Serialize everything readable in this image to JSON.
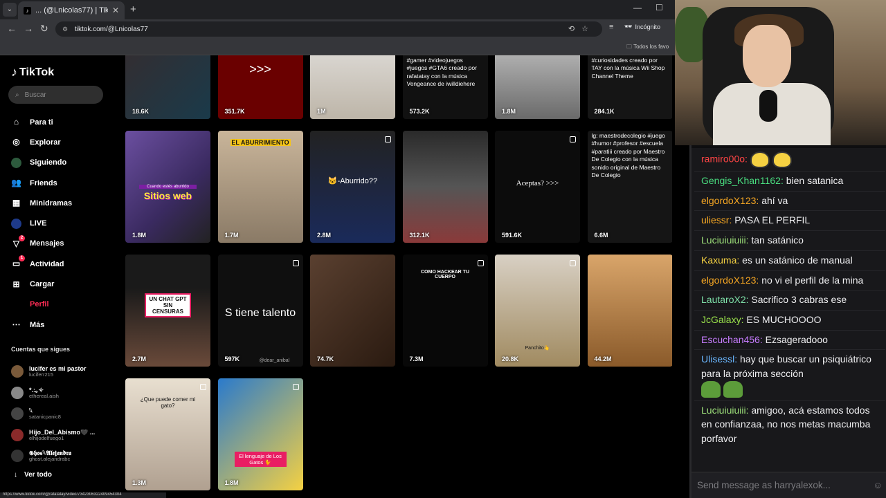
{
  "browser": {
    "tab_title": "... (@Lnicolas77) | TikTok",
    "url": "tiktok.com/@Lnicolas77",
    "incognito_label": "Incógnito",
    "bookmarks_label": "Todos los favo",
    "status_url": "https://www.tiktok.com/@rafatatay/video/7342306322409454304"
  },
  "tiktok": {
    "logo": "TikTok",
    "search_placeholder": "Buscar",
    "nav": [
      {
        "label": "Para ti",
        "icon": "home-icon"
      },
      {
        "label": "Explorar",
        "icon": "compass-icon"
      },
      {
        "label": "Siguiendo",
        "icon": "following-avatar-icon"
      },
      {
        "label": "Friends",
        "icon": "friends-icon"
      },
      {
        "label": "Minidramas",
        "icon": "minidramas-icon"
      },
      {
        "label": "LIVE",
        "icon": "live-icon"
      },
      {
        "label": "Mensajes",
        "icon": "messages-icon",
        "badge": "2"
      },
      {
        "label": "Actividad",
        "icon": "activity-icon",
        "badge": "1"
      },
      {
        "label": "Cargar",
        "icon": "upload-icon"
      },
      {
        "label": "Perfil",
        "icon": "profile-icon"
      },
      {
        "label": "Más",
        "icon": "more-icon"
      }
    ],
    "following_title": "Cuentas que sigues",
    "following": [
      {
        "name": "lucifer es mi pastor",
        "handle": "luciferr215"
      },
      {
        "name": "*.:｡✧",
        "handle": "ethereal.aish"
      },
      {
        "name": "𓆩",
        "handle": "satanicpanic8"
      },
      {
        "name": "Hijo_Del_Abismo🖤 ...",
        "handle": "elhijodelfuego1"
      },
      {
        "name": "𝕲𝖍𝖔𝖘𓆩𝕬𝖑𝖊𝖏𝖆𝖓𝖉𝖗𝖆",
        "handle": "ghost.alejandrabc"
      }
    ],
    "see_all": "Ver todo",
    "videos": [
      {
        "views": "18.6K"
      },
      {
        "views": "351.7K",
        "overlay": ">>>"
      },
      {
        "views": "1M"
      },
      {
        "views": "573.2K",
        "caption": "#gamer #videojuegos #juegos #GTA6 creado por rafatatay con la música Vengeance de iwilldiehere"
      },
      {
        "views": "1.8M"
      },
      {
        "views": "284.1K",
        "caption": "#curiosidades creado por TAY con la música Wii Shop Channel Theme"
      },
      {
        "views": "1.8M",
        "overlay": "Sitios web",
        "subtitle": "Cuando estés aburrido"
      },
      {
        "views": "1.7M",
        "overlay": "EL ABURRIMIENTO"
      },
      {
        "views": "2.8M",
        "overlay": "🐱-Aburrido??"
      },
      {
        "views": "312.1K"
      },
      {
        "views": "591.6K",
        "overlay": "Aceptas? >>>"
      },
      {
        "views": "6.6M",
        "caption": "lg: maestrodecolegio #juego #humor #profesor #escuela #paratiii creado por Maestro De Colegio con la música sonido original de Maestro De Colegio"
      },
      {
        "views": "2.7M",
        "overlay": "UN CHAT GPT SIN CENSURAS"
      },
      {
        "views": "597K",
        "overlay": "S tiene talento",
        "handle": "@dear_anibal"
      },
      {
        "views": "74.7K"
      },
      {
        "views": "7.3M",
        "overlay": "COMO HACKEAR TU CUERPO"
      },
      {
        "views": "20.8K",
        "overlay": "Panchito👆"
      },
      {
        "views": "44.2M"
      },
      {
        "views": "1.3M",
        "overlay": "¿Que puede comer mi gato?"
      },
      {
        "views": "1.8M",
        "overlay": "El lenguaje de Los Gatos 🐈"
      }
    ]
  },
  "chat": {
    "messages": [
      {
        "user": "ramiro00o:",
        "color": "#ff4545",
        "text": "",
        "emotes": [
          "cat-emote",
          "cat-emote"
        ]
      },
      {
        "user": "Gengis_Khan1162:",
        "color": "#4ade80",
        "text": "bien satanica"
      },
      {
        "user": "elgordoX123:",
        "color": "#f5a623",
        "text": "ahí va"
      },
      {
        "user": "uliessr:",
        "color": "#f5a623",
        "text": "PASA EL PERFIL"
      },
      {
        "user": "Luciuiuiuiii:",
        "color": "#9de07a",
        "text": "tan satánico"
      },
      {
        "user": "Kaxuma:",
        "color": "#f5d142",
        "text": "es un satánico de manual"
      },
      {
        "user": "elgordoX123:",
        "color": "#f5a623",
        "text": "no vi el perfil de la mina"
      },
      {
        "user": "LautaroX2:",
        "color": "#7ee0a8",
        "text": "Sacrifico 3 cabras ese"
      },
      {
        "user": "JcGalaxy:",
        "color": "#9be34b",
        "text": "ES MUCHOOOO"
      },
      {
        "user": "Escuchan456:",
        "color": "#c77dff",
        "text": "Ezsageradooo"
      },
      {
        "user": "Ulisessl:",
        "color": "#6ab7ff",
        "text": "hay que buscar un psiquiátrico para la próxima sección",
        "emotes": [
          "frog-emote",
          "frog-emote"
        ]
      },
      {
        "user": "Luciuiuiuiii:",
        "color": "#9de07a",
        "text": "amigoo, acá estamos todos en confianzaa, no nos metas macumba porfavor"
      }
    ],
    "input_placeholder": "Send message as harryalexok..."
  }
}
